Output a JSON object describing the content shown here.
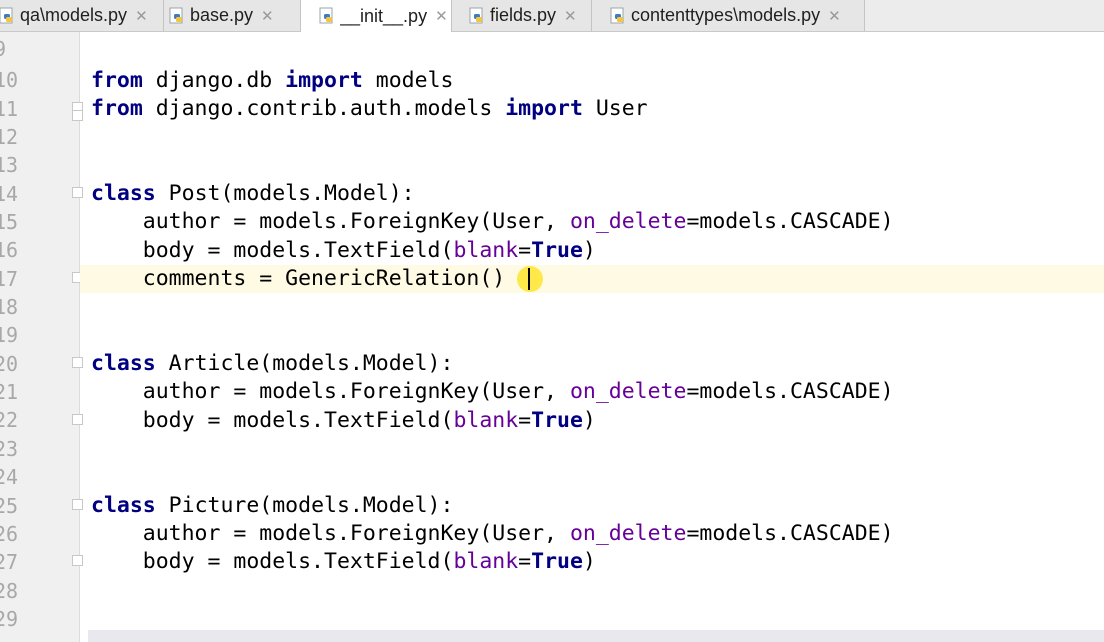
{
  "tabs": [
    {
      "label": "qa\\models.py",
      "active": false
    },
    {
      "label": "base.py",
      "active": false
    },
    {
      "label": "__init__.py",
      "active": true
    },
    {
      "label": "fields.py",
      "active": false
    },
    {
      "label": "contenttypes\\models.py",
      "active": false
    }
  ],
  "line_numbers": [
    "9",
    "10",
    "11",
    "12",
    "13",
    "14",
    "15",
    "16",
    "17",
    "18",
    "19",
    "20",
    "21",
    "22",
    "23",
    "24",
    "25",
    "26",
    "27",
    "28",
    "29"
  ],
  "code": {
    "l10": [
      {
        "t": "from",
        "c": "kw"
      },
      {
        "t": " django.db "
      },
      {
        "t": "import",
        "c": "kw"
      },
      {
        "t": " models"
      }
    ],
    "l11": [
      {
        "t": "from",
        "c": "kw"
      },
      {
        "t": " django.contrib.auth.models "
      },
      {
        "t": "import",
        "c": "kw"
      },
      {
        "t": " User"
      }
    ],
    "l14": [
      {
        "t": "class",
        "c": "kw"
      },
      {
        "t": " Post(models.Model):"
      }
    ],
    "l15": [
      {
        "t": "    author = models.ForeignKey(User, "
      },
      {
        "t": "on_delete",
        "c": "param"
      },
      {
        "t": "=models.CASCADE)"
      }
    ],
    "l16": [
      {
        "t": "    body = models.TextField("
      },
      {
        "t": "blank",
        "c": "param"
      },
      {
        "t": "="
      },
      {
        "t": "True",
        "c": "kw"
      },
      {
        "t": ")"
      }
    ],
    "l17": [
      {
        "t": "    comments = GenericRelation()"
      }
    ],
    "l20": [
      {
        "t": "class",
        "c": "kw"
      },
      {
        "t": " Article(models.Model):"
      }
    ],
    "l21": [
      {
        "t": "    author = models.ForeignKey(User, "
      },
      {
        "t": "on_delete",
        "c": "param"
      },
      {
        "t": "=models.CASCADE)"
      }
    ],
    "l22": [
      {
        "t": "    body = models.TextField("
      },
      {
        "t": "blank",
        "c": "param"
      },
      {
        "t": "="
      },
      {
        "t": "True",
        "c": "kw"
      },
      {
        "t": ")"
      }
    ],
    "l25": [
      {
        "t": "class",
        "c": "kw"
      },
      {
        "t": " Picture(models.Model):"
      }
    ],
    "l26": [
      {
        "t": "    author = models.ForeignKey(User, "
      },
      {
        "t": "on_delete",
        "c": "param"
      },
      {
        "t": "=models.CASCADE)"
      }
    ],
    "l27": [
      {
        "t": "    body = models.TextField("
      },
      {
        "t": "blank",
        "c": "param"
      },
      {
        "t": "="
      },
      {
        "t": "True",
        "c": "kw"
      },
      {
        "t": ")"
      }
    ]
  }
}
